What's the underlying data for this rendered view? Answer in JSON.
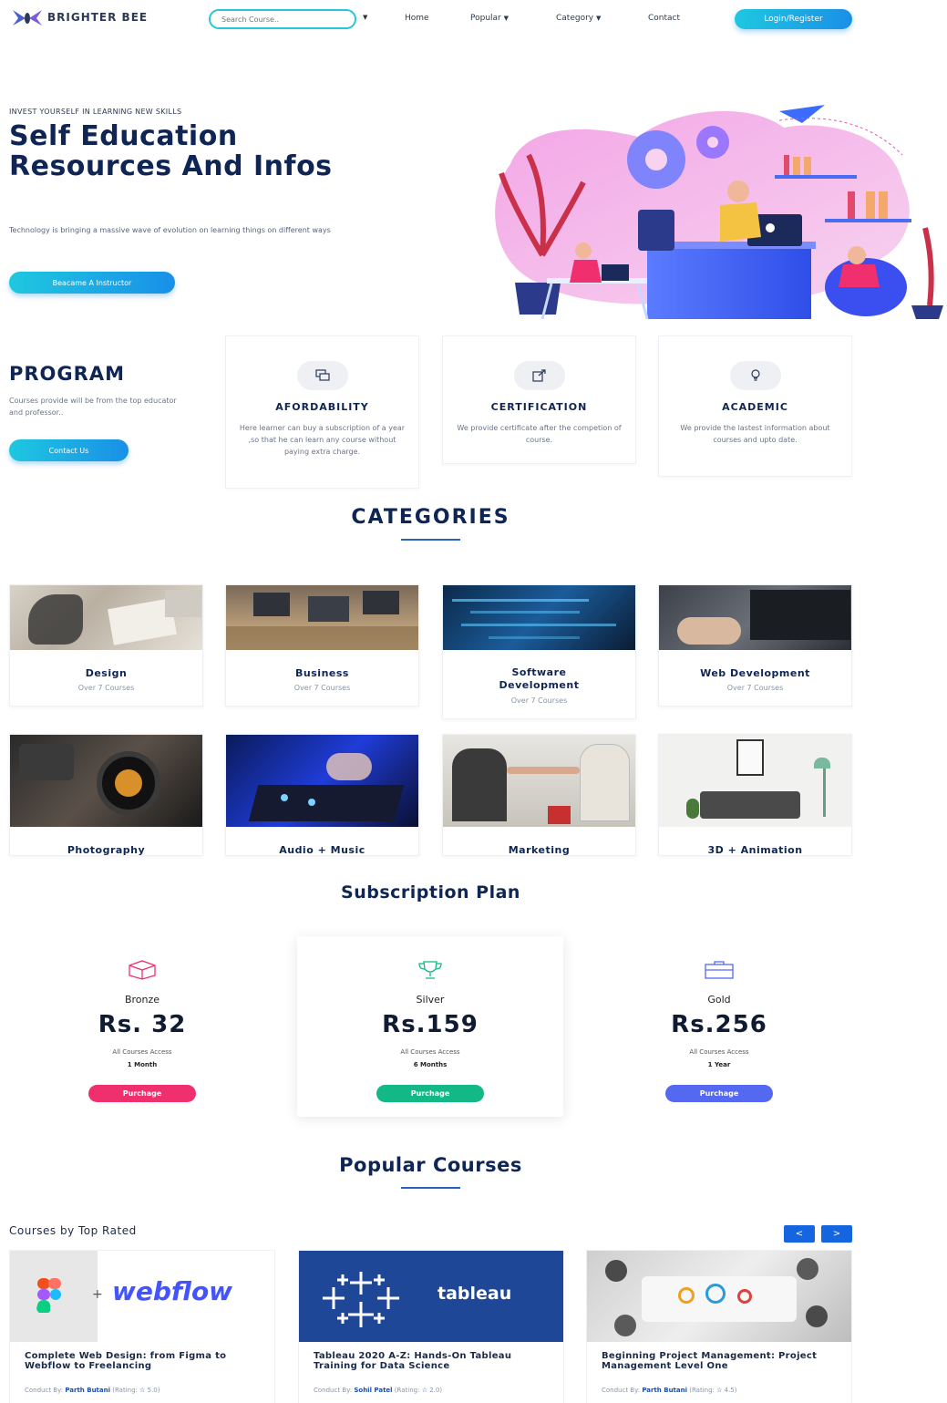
{
  "nav": {
    "logo_text": "BRIGHTER BEE",
    "search_placeholder": "Search Course..",
    "links": [
      "Home",
      "Popular",
      "Category",
      "Contact"
    ],
    "login_label": "Login/Register"
  },
  "hero": {
    "eyebrow": "INVEST YOURSELF IN LEARNING NEW SKILLS",
    "title": "Self Education Resources And Infos",
    "description": "Technology is bringing a massive wave of evolution on learning things on different ways",
    "button_label": "Beacame A Instructor"
  },
  "program": {
    "title": "PROGRAM",
    "description": "Courses provide will be from the top educator and professor..",
    "button_label": "Contact Us",
    "features": [
      {
        "title": "AFORDABILITY",
        "text": "Here learner can buy a subscription of a year ,so that he can learn any course without paying extra charge."
      },
      {
        "title": "CERTIFICATION",
        "text": "We provide certificate after the competion of course."
      },
      {
        "title": "ACADEMIC",
        "text": "We provide the lastest information about courses and upto date."
      }
    ]
  },
  "categories": {
    "title": "CATEGORIES",
    "items": [
      {
        "name": "Design",
        "sub": "Over 7 Courses"
      },
      {
        "name": "Business",
        "sub": "Over 7 Courses"
      },
      {
        "name": "Software Development",
        "sub": "Over 7 Courses"
      },
      {
        "name": "Web Development",
        "sub": "Over 7 Courses"
      },
      {
        "name": "Photography",
        "sub": ""
      },
      {
        "name": "Audio + Music",
        "sub": ""
      },
      {
        "name": "Marketing",
        "sub": ""
      },
      {
        "name": "3D + Animation",
        "sub": ""
      }
    ]
  },
  "plans": {
    "title": "Subscription Plan",
    "items": [
      {
        "name": "Bronze",
        "price": "Rs. 32",
        "access": "All Courses Access",
        "duration": "1 Month",
        "button": "Purchage",
        "color": "#f0306e"
      },
      {
        "name": "Silver",
        "price": "Rs.159",
        "access": "All Courses Access",
        "duration": "6 Months",
        "button": "Purchage",
        "color": "#12b886"
      },
      {
        "name": "Gold",
        "price": "Rs.256",
        "access": "All Courses Access",
        "duration": "1 Year",
        "button": "Purchage",
        "color": "#5468f0"
      }
    ]
  },
  "courses": {
    "title": "Popular Courses",
    "subtitle": "Courses by Top Rated",
    "prev": "<",
    "next": ">",
    "by_label": "Conduct By:",
    "items": [
      {
        "title": "Complete Web Design: from Figma to Webflow to Freelancing",
        "author": "Parth Butani",
        "rating": "5.0",
        "brand_left": "+",
        "brand_right": "webflow"
      },
      {
        "title": "Tableau 2020 A-Z: Hands-On Tableau Training for Data Science",
        "author": "Sohil Patel",
        "rating": "2.0",
        "brand_right": "tableau"
      },
      {
        "title": "Beginning Project Management: Project Management Level One",
        "author": "Parth Butani",
        "rating": "4.5"
      }
    ]
  },
  "colors": {
    "primary_dark": "#0f2554",
    "accent_gradient_start": "#1ec8e0",
    "accent_gradient_end": "#1a8fe8",
    "arrow_blue": "#1665e0"
  }
}
